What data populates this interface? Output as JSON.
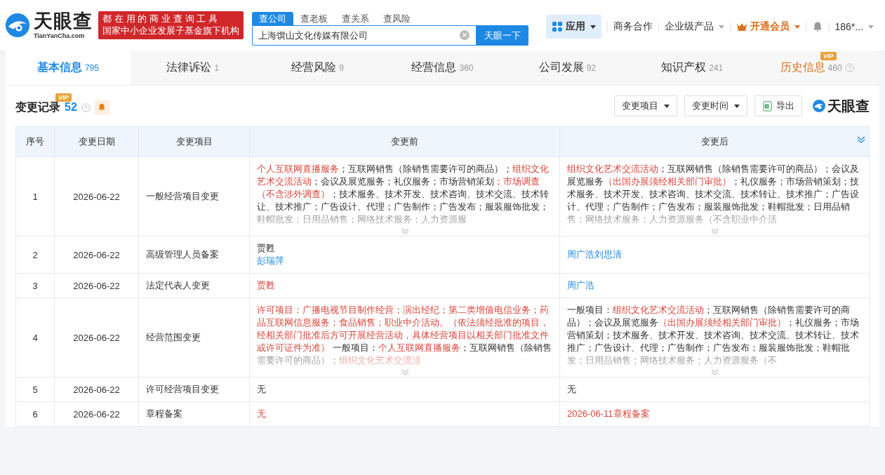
{
  "header": {
    "logo": {
      "name": "天眼查",
      "domain": "TianYanCha.com"
    },
    "slogan": [
      "都在用的商业查询工具",
      "国家中小企业发展子基金旗下机构"
    ],
    "search_tabs": [
      {
        "label": "查公司",
        "selected": true
      },
      {
        "label": "查老板",
        "selected": false
      },
      {
        "label": "查关系",
        "selected": false
      },
      {
        "label": "查风险",
        "selected": false
      }
    ],
    "search": {
      "value": "上海馔山文化传媒有限公司",
      "button": "天眼一下"
    },
    "nav": [
      {
        "label": "应用",
        "kind": "apps",
        "caret": true
      },
      {
        "label": "商务合作",
        "kind": "plain"
      },
      {
        "label": "企业级产品",
        "kind": "plain",
        "caret": true
      },
      {
        "label": "开通会员",
        "kind": "vip",
        "caret": true
      },
      {
        "kind": "bell"
      },
      {
        "label": "186*...",
        "kind": "plain",
        "caret": true
      }
    ]
  },
  "tabs": [
    {
      "label": "基本信息",
      "count": "795",
      "selected": true
    },
    {
      "label": "法律诉讼",
      "count": "1",
      "selected": false
    },
    {
      "label": "经营风险",
      "count": "9",
      "selected": false
    },
    {
      "label": "经营信息",
      "count": "360",
      "selected": false
    },
    {
      "label": "公司发展",
      "count": "92",
      "selected": false
    },
    {
      "label": "知识产权",
      "count": "241",
      "selected": false
    },
    {
      "label": "历史信息",
      "count": "460",
      "selected": false,
      "badge": "VIP",
      "help": true
    }
  ],
  "section": {
    "title": "变更记录",
    "count": "52",
    "badge": "VIP",
    "filters": [
      "变更项目",
      "变更时间"
    ],
    "export": "导出",
    "brand": "天眼查"
  },
  "table": {
    "columns": [
      "序号",
      "变更日期",
      "变更项目",
      "变更前",
      "变更后"
    ],
    "rows": [
      {
        "index": "1",
        "date": "2026-06-22",
        "item": "一般经营项目变更",
        "before": {
          "collapsed": true,
          "lines": [
            [
              {
                "text": "个人互联网直播服务",
                "kind": "highlight"
              },
              {
                "text": "；互联网销售（除销售需要许可的商品）；",
                "kind": "plain"
              },
              {
                "text": "组织文化艺术交流活动",
                "kind": "highlight"
              },
              {
                "text": "；会议及展览服务；礼仪服务；市场营销策划",
                "kind": "plain"
              },
              {
                "text": "；市场调查（不含涉外调查）",
                "kind": "highlight"
              },
              {
                "text": "；技术服务、技术开发、技术咨询、技术交流、技术转让、技术推广；广告设计、代理；广告制作；广告发布；服装服饰批发；鞋帽批发；日用品销售；网络技术服务；人力资源服",
                "kind": "plain"
              }
            ]
          ]
        },
        "after": {
          "collapsed": true,
          "lines": [
            [
              {
                "text": "组织文化艺术交流活动",
                "kind": "highlight"
              },
              {
                "text": "；互联网销售（除销售需要许可的商品）；会议及展览服务",
                "kind": "plain"
              },
              {
                "text": "（出国办展须经相关部门审批）",
                "kind": "highlight"
              },
              {
                "text": "；礼仪服务；市场营销策划；技术服务、技术开发、技术咨询、技术交流、技术转让、技术推广；广告设计、代理；广告制作；广告发布；服装服饰批发；鞋帽批发；日用品销售；网络技术服务；人力资源服务（不含职业中介活",
                "kind": "plain"
              }
            ]
          ]
        }
      },
      {
        "index": "2",
        "date": "2026-06-22",
        "item": "高级管理人员备案",
        "before": {
          "lines": [
            [
              {
                "text": "贾甦",
                "kind": "plain"
              }
            ],
            [
              {
                "text": "彭瑞萍",
                "kind": "person"
              }
            ]
          ]
        },
        "after": {
          "lines": [
            [
              {
                "text": "周广浩刘思清",
                "kind": "person"
              }
            ]
          ]
        }
      },
      {
        "index": "3",
        "date": "2026-06-22",
        "item": "法定代表人变更",
        "before": {
          "lines": [
            [
              {
                "text": "贾甦",
                "kind": "highlight"
              }
            ]
          ]
        },
        "after": {
          "lines": [
            [
              {
                "text": "周广浩",
                "kind": "person"
              }
            ]
          ]
        }
      },
      {
        "index": "4",
        "date": "2026-06-22",
        "item": "经营范围变更",
        "before": {
          "collapsed": true,
          "lines": [
            [
              {
                "text": "许可项目：广播电视节目制作经营；演出经纪；第二类增值电信业务；药品互联网信息服务；食品销售；职业中介活动。（依法须经批准的项目，经相关部门批准后方可开展经营活动，具体经营项目以相关部门批准文件或许可证件为准）",
                "kind": "highlight"
              },
              {
                "text": " 一般项目：",
                "kind": "plain"
              },
              {
                "text": "个人互联网直播服务",
                "kind": "highlight"
              },
              {
                "text": "；互联网销售（除销售需要许可的商品）；",
                "kind": "plain"
              },
              {
                "text": "组织文化艺术交流活",
                "kind": "highlight"
              }
            ]
          ]
        },
        "after": {
          "collapsed": true,
          "lines": [
            [
              {
                "text": "一般项目：",
                "kind": "plain"
              },
              {
                "text": "组织文化艺术交流活动",
                "kind": "highlight"
              },
              {
                "text": "；互联网销售（除销售需要许可的商品）；会议及展览服务",
                "kind": "plain"
              },
              {
                "text": "（出国办展须经相关部门审批）",
                "kind": "highlight"
              },
              {
                "text": "；礼仪服务；市场营销策划；技术服务、技术开发、技术咨询、技术交流、技术转让、技术推广；广告设计、代理；广告制作；广告发布；服装服饰批发；鞋帽批发；日用品销售；网络技术服务；人力资源服务（不",
                "kind": "plain"
              }
            ]
          ]
        }
      },
      {
        "index": "5",
        "date": "2026-06-22",
        "item": "许可经营项目变更",
        "before": {
          "lines": [
            [
              {
                "text": "无",
                "kind": "plain"
              }
            ]
          ]
        },
        "after": {
          "lines": [
            [
              {
                "text": "无",
                "kind": "plain"
              }
            ]
          ]
        }
      },
      {
        "index": "6",
        "date": "2026-06-22",
        "item": "章程备案",
        "before": {
          "lines": [
            [
              {
                "text": "无",
                "kind": "highlight"
              }
            ]
          ]
        },
        "after": {
          "lines": [
            [
              {
                "text": "2026-06-11章程备案",
                "kind": "highlight"
              }
            ]
          ]
        }
      }
    ]
  }
}
